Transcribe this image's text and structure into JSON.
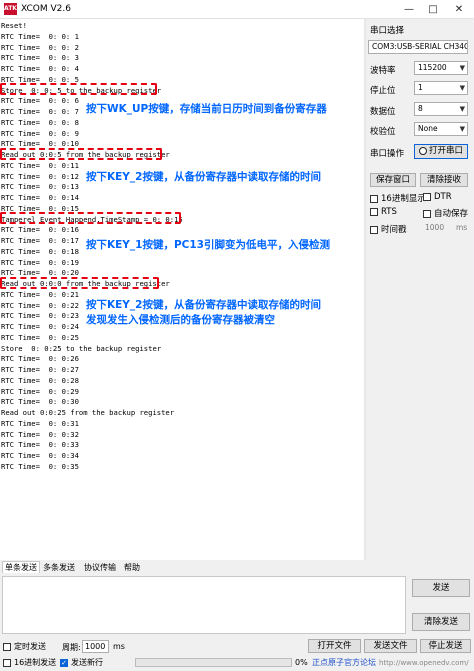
{
  "window": {
    "app_icon": "ATK",
    "title": "XCOM V2.6"
  },
  "log_lines": [
    "Reset!",
    "RTC Time=  0: 0: 1",
    "RTC Time=  0: 0: 2",
    "RTC Time=  0: 0: 3",
    "RTC Time=  0: 0: 4",
    "RTC Time=  0: 0: 5",
    "Store  0: 0: 5 to the backup register",
    "RTC Time=  0: 0: 6",
    "RTC Time=  0: 0: 7",
    "RTC Time=  0: 0: 8",
    "RTC Time=  0: 0: 9",
    "RTC Time=  0: 0:10",
    "Read out 0:0:5 from the backup register",
    "RTC Time=  0: 0:11",
    "RTC Time=  0: 0:12",
    "RTC Time=  0: 0:13",
    "RTC Time=  0: 0:14",
    "RTC Time=  0: 0:15",
    "Tamperel Event Happend.TimeStamp = 0: 0:15",
    "RTC Time=  0: 0:16",
    "RTC Time=  0: 0:17",
    "RTC Time=  0: 0:18",
    "RTC Time=  0: 0:19",
    "RTC Time=  0: 0:20",
    "Read out 0:0:0 from the backup register",
    "RTC Time=  0: 0:21",
    "RTC Time=  0: 0:22",
    "RTC Time=  0: 0:23",
    "RTC Time=  0: 0:24",
    "RTC Time=  0: 0:25",
    "Store  0: 0:25 to the backup register",
    "RTC Time=  0: 0:26",
    "RTC Time=  0: 0:27",
    "RTC Time=  0: 0:28",
    "RTC Time=  0: 0:29",
    "RTC Time=  0: 0:30",
    "Read out 0:0:25 from the backup register",
    "RTC Time=  0: 0:31",
    "RTC Time=  0: 0:32",
    "RTC Time=  0: 0:33",
    "RTC Time=  0: 0:34",
    "RTC Time=  0: 0:35"
  ],
  "annotations": [
    "按下WK_UP按键，存储当前日历时间到备份寄存器",
    "按下KEY_2按键，从备份寄存器中读取存储的时间",
    "按下KEY_1按键，PC13引脚变为低电平，入侵检测",
    "按下KEY_2按键，从备份寄存器中读取存储的时间",
    "发现发生入侵检测后的备份寄存器被清空"
  ],
  "panel": {
    "port_select_label": "串口选择",
    "port_value": "COM3:USB-SERIAL CH34C",
    "baud_label": "波特率",
    "baud_value": "115200",
    "stopbits_label": "停止位",
    "stopbits_value": "1",
    "databits_label": "数据位",
    "databits_value": "8",
    "parity_label": "校验位",
    "parity_value": "None",
    "port_op_label": "串口操作",
    "open_port_button": "打开串口",
    "save_window_button": "保存窗口",
    "clear_recv_button": "清除接收",
    "hex_display_label": "16进制显示",
    "dtr_label": "DTR",
    "rts_label": "RTS",
    "autosave_label": "自动保存",
    "timestamp_label": "时间戳",
    "timestamp_value": "1000",
    "timestamp_unit": "ms"
  },
  "tabs": [
    "单条发送",
    "多条发送",
    "协议传输",
    "帮助"
  ],
  "send": {
    "send_button": "发送",
    "clear_send_button": "清除发送",
    "timed_send_label": "定时发送",
    "period_label": "周期:",
    "period_value": "1000",
    "period_unit": "ms",
    "open_file_button": "打开文件",
    "send_file_button": "发送文件",
    "stop_send_button": "停止发送",
    "hex_send_label": "16进制发送",
    "send_newline_label": "发送新行",
    "progress_value": 0,
    "progress_text": "0%"
  },
  "watermark": {
    "text": "正点原子官方论坛",
    "url": "http://www.openedv.com/"
  },
  "colors": {
    "annotation": "#0066ff",
    "highlight": "#e60012"
  }
}
